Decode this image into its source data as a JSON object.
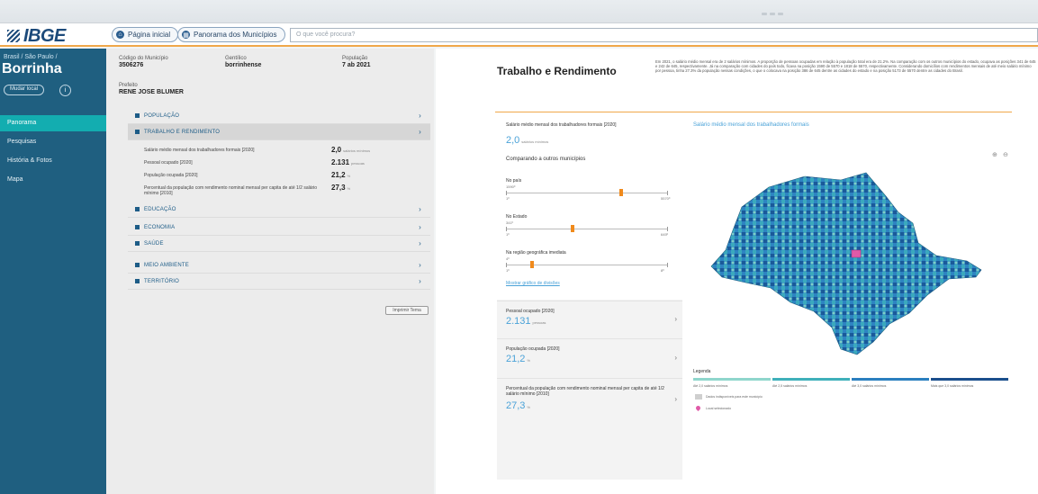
{
  "header": {
    "logo": "IBGE",
    "home_button": "Página inicial",
    "panorama_button": "Panorama dos Municípios",
    "search_placeholder": "O que você procura?"
  },
  "sidebar": {
    "crumb": "Brasil / São Paulo /",
    "city": "Borrinha",
    "change_label": "Mudar local",
    "nav": [
      {
        "label": "Panorama",
        "active": true
      },
      {
        "label": "Pesquisas",
        "active": false
      },
      {
        "label": "História & Fotos",
        "active": false
      },
      {
        "label": "Mapa",
        "active": false
      }
    ]
  },
  "summary": {
    "code_label": "Código do Município",
    "code_value": "3506276",
    "gentilic_label": "Gentílico",
    "gentilic_value": "borrinhense",
    "mayor_label": "Prefeito",
    "mayor_value": "RENE JOSE BLUMER",
    "pop_label": "População",
    "pop_value": "7 ab 2021"
  },
  "categories": [
    {
      "label": "POPULAÇÃO",
      "open": false
    },
    {
      "label": "TRABALHO E RENDIMENTO",
      "open": true
    },
    {
      "label": "EDUCAÇÃO",
      "open": false
    },
    {
      "label": "ECONOMIA",
      "open": false
    },
    {
      "label": "SAÚDE",
      "open": false
    },
    {
      "label": "MEIO AMBIENTE",
      "open": false
    },
    {
      "label": "TERRITÓRIO",
      "open": false
    }
  ],
  "rows": [
    {
      "label": "Salário médio mensal dos trabalhadores formais [2020]",
      "value": "2,0",
      "unit": "salários mínimos"
    },
    {
      "label": "Pessoal ocupado [2020]",
      "value": "2.131",
      "unit": "pessoas"
    },
    {
      "label": "População ocupada [2020]",
      "value": "21,2",
      "unit": "%"
    },
    {
      "label": "Percentual da população com rendimento nominal mensal per capita de até 1/2 salário mínimo [2010]",
      "value": "27,3",
      "unit": "%"
    }
  ],
  "print_label": "Imprimir Tema",
  "right": {
    "title": "Trabalho e Rendimento",
    "description": "Em 2021, o salário médio mensal era de 2 salários mínimos. A proporção de pessoas ocupadas em relação à população total era de 21.2%. Na comparação com os outros municípios do estado, ocupava as posições 341 de 645 e 242 de 645, respectivamente. Já na comparação com cidades do país todo, ficava na posição 1590 de 5570 e 1818 de 5570, respectivamente. Considerando domicílios com rendimentos mensais de até meio salário mínimo por pessoa, tinha 27.3% da população nessas condições, o que o colocava na posição 386 de 645 dentre as cidades do estado e na posição 5173 de 5570 dentre as cidades do Brasil.",
    "main_card": {
      "label": "Salário médio mensal dos trabalhadores formais [2020]",
      "value": "2,0",
      "unit": "salários mínimos",
      "compare_label": "Comparando a outros municípios",
      "sliders": [
        {
          "title": "No país",
          "rank": "1590º",
          "left": "1º",
          "right": "5570º",
          "thumb_fraction": 0.7
        },
        {
          "title": "No Estado",
          "rank": "341º",
          "left": "1º",
          "right": "645º",
          "thumb_fraction": 0.4
        },
        {
          "title": "Na região geográfica imediata",
          "rank": "4º",
          "left": "1º",
          "right": "8º",
          "thumb_fraction": 0.15
        }
      ],
      "link": "Mostrar gráfico de divisões"
    },
    "cards": [
      {
        "label": "Pessoal ocupado [2020]",
        "value": "2.131",
        "unit": "pessoas"
      },
      {
        "label": "População ocupada [2020]",
        "value": "21,2",
        "unit": "%"
      },
      {
        "label": "Percentual da população com rendimento nominal mensal per capita de até 1/2 salário mínimo [2010]",
        "value": "27,3",
        "unit": "%"
      }
    ],
    "map": {
      "title": "Salário médio mensal dos trabalhadores formais",
      "legend_title": "Legenda",
      "legend": [
        "Até 2,0 salários mínimos",
        "Até 2,5 salários mínimos",
        "Até 3,0 salários mínimos",
        "Mais que 3,0 salários mínimos"
      ],
      "no_data": "Dados indisponíveis para este município",
      "selected": "Local selecionado",
      "colors": [
        "#8fd6cc",
        "#3fb0ba",
        "#2b7fbf",
        "#1a4e8c"
      ]
    }
  }
}
